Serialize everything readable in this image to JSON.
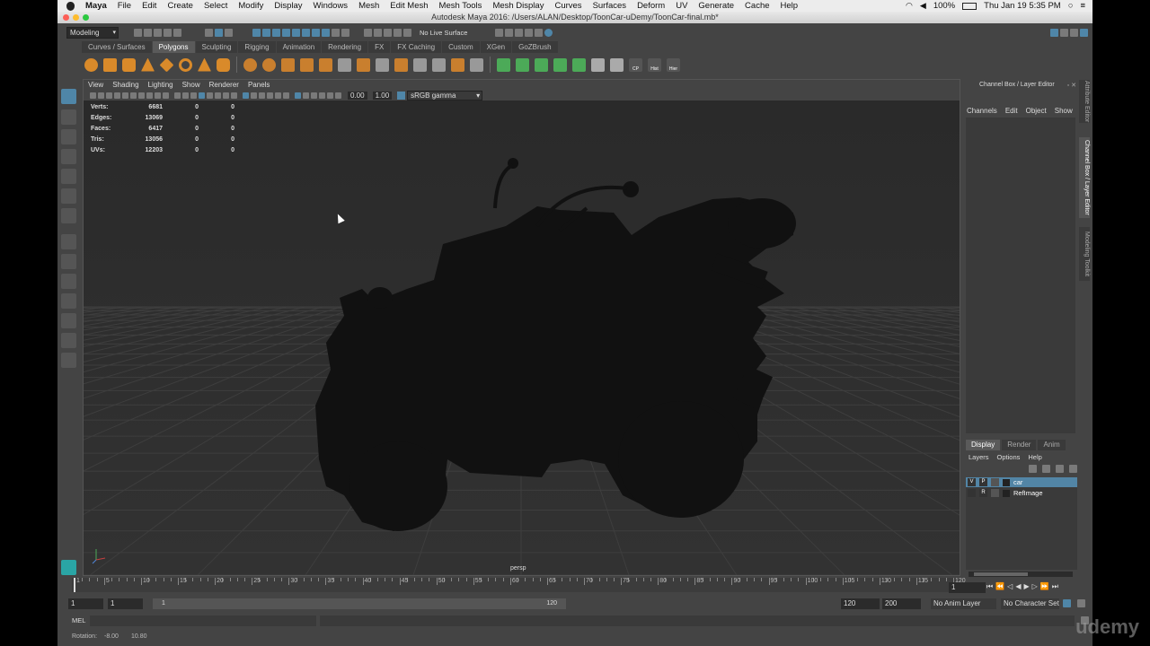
{
  "mac_menu": {
    "app": "Maya",
    "items": [
      "File",
      "Edit",
      "Create",
      "Select",
      "Modify",
      "Display",
      "Windows",
      "Mesh",
      "Edit Mesh",
      "Mesh Tools",
      "Mesh Display",
      "Curves",
      "Surfaces",
      "Deform",
      "UV",
      "Generate",
      "Cache",
      "Help"
    ],
    "battery": "100%",
    "clock": "Thu Jan 19  5:35 PM"
  },
  "window": {
    "title": "Autodesk Maya 2016: /Users/ALAN/Desktop/ToonCar-uDemy/ToonCar-final.mb*"
  },
  "status_line": {
    "mode": "Modeling",
    "live_surface": "No Live Surface"
  },
  "shelf": {
    "tabs": [
      "Curves / Surfaces",
      "Polygons",
      "Sculpting",
      "Rigging",
      "Animation",
      "Rendering",
      "FX",
      "FX Caching",
      "Custom",
      "XGen",
      "GoZBrush"
    ],
    "active_tab": "Polygons",
    "icon_labels": [
      "CP",
      "Hist",
      "Hier"
    ]
  },
  "viewport": {
    "menu": [
      "View",
      "Shading",
      "Lighting",
      "Show",
      "Renderer",
      "Panels"
    ],
    "exposure": "0.00",
    "gamma": "1.00",
    "color_space": "sRGB gamma",
    "camera": "persp",
    "hud": [
      {
        "label": "Verts:",
        "a": "6681",
        "b": "0",
        "c": "0"
      },
      {
        "label": "Edges:",
        "a": "13069",
        "b": "0",
        "c": "0"
      },
      {
        "label": "Faces:",
        "a": "6417",
        "b": "0",
        "c": "0"
      },
      {
        "label": "Tris:",
        "a": "13056",
        "b": "0",
        "c": "0"
      },
      {
        "label": "UVs:",
        "a": "12203",
        "b": "0",
        "c": "0"
      }
    ]
  },
  "channel_box": {
    "title": "Channel Box / Layer Editor",
    "menu": [
      "Channels",
      "Edit",
      "Object",
      "Show"
    ],
    "layer_tabs": [
      "Display",
      "Render",
      "Anim"
    ],
    "active_layer_tab": "Display",
    "layer_menu": [
      "Layers",
      "Options",
      "Help"
    ],
    "layers": [
      {
        "v": "V",
        "p": "P",
        "name": "car",
        "selected": true
      },
      {
        "v": "",
        "p": "R",
        "name": "RefImage",
        "selected": false
      }
    ]
  },
  "side_tabs": [
    "Attribute Editor",
    "Channel Box / Layer Editor",
    "Modeling Toolkit"
  ],
  "timeline": {
    "ticks": [
      "1",
      "5",
      "10",
      "15",
      "20",
      "25",
      "30",
      "35",
      "40",
      "45",
      "50",
      "55",
      "60",
      "65",
      "70",
      "75",
      "80",
      "85",
      "90",
      "95",
      "100",
      "105",
      "110",
      "115",
      "120"
    ],
    "current_frame": "1"
  },
  "range": {
    "start": "1",
    "playback_start": "1",
    "slider_start": "1",
    "slider_end": "120",
    "playback_end": "120",
    "end": "200",
    "anim_layer": "No Anim Layer",
    "character_set": "No Character Set"
  },
  "command_line": {
    "lang": "MEL"
  },
  "help_line": {
    "label": "Rotation:",
    "x": "-8.00",
    "y": "10.80"
  },
  "watermark": "udemy"
}
